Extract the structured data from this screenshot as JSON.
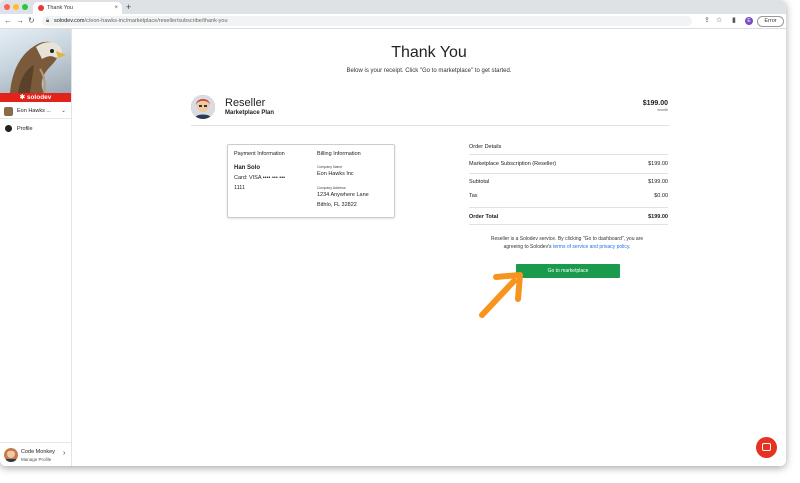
{
  "browser": {
    "tab_title": "Thank You",
    "tab_close": "×",
    "new_tab": "+",
    "url_host": "solodev.com",
    "url_path": "/c/eon-hawks-inc/marketplace/reseller/subscribe/thank-you",
    "profile_initial": "E",
    "error_label": "Error"
  },
  "sidebar": {
    "brand": "✱ solodev",
    "company": "Eon Hawks ...",
    "nav": [
      {
        "label": "Profile"
      }
    ],
    "user": {
      "name": "Code Monkey",
      "sub": "Manage Profile"
    }
  },
  "main": {
    "title": "Thank You",
    "subtitle": "Below is your receipt. Click \"Go to marketplace\" to get started.",
    "plan": {
      "title": "Reseller",
      "subtitle": "Marketplace Plan",
      "price": "$199.00",
      "per": "/month"
    },
    "payment": {
      "heading": "Payment Information",
      "name": "Han Solo",
      "card_line1": "Card: VISA •••• ••• •••",
      "card_line2": "1111"
    },
    "billing": {
      "heading": "Billing Information",
      "company_caption": "Company Name",
      "company": "Eon Hawks Inc",
      "address_caption": "Company Address",
      "address1": "1234 Anywhere Lane",
      "address2": "Bithlo, FL 32822"
    },
    "order": {
      "heading": "Order Details",
      "item_label": "Marketplace Subscription (Reseller)",
      "item_value": "$199.00",
      "subtotal_label": "Subtotal",
      "subtotal_value": "$199.00",
      "tax_label": "Tax",
      "tax_value": "$0.00",
      "total_label": "Order Total",
      "total_value": "$199.00"
    },
    "terms": {
      "line1": "Reseller is a Solodev service. By clicking \"Go to dashboard\", you are",
      "line2_prefix": "agreeing to Solodev's ",
      "link": "terms of service and privacy policy",
      "line2_suffix": "."
    },
    "cta": "Go to marketplace"
  },
  "colors": {
    "brand_red": "#e32219",
    "cta_green": "#1a9a4d",
    "arrow_orange": "#f7941d",
    "link_blue": "#1a73e8"
  }
}
